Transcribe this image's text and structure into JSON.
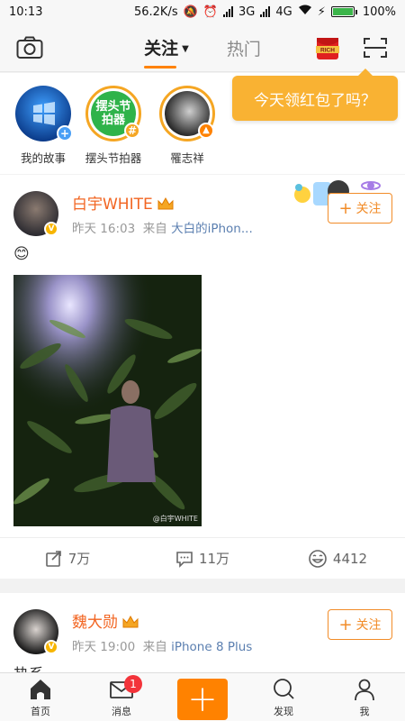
{
  "status_bar": {
    "time": "10:13",
    "net_speed": "56.2K/s",
    "net_3g": "3G",
    "net_4g": "4G",
    "battery": "100%"
  },
  "top_nav": {
    "tabs": [
      {
        "label": "关注",
        "active": true
      },
      {
        "label": "热门",
        "active": false
      }
    ],
    "rich_label": "RICH",
    "accent_color": "#ff8200"
  },
  "tooltip": {
    "text": "今天领红包了吗？"
  },
  "stories": [
    {
      "label": "我的故事",
      "badge": "+",
      "badge_color": "#4a9ff5"
    },
    {
      "label": "摆头节拍器",
      "badge": "#",
      "badge_color": "#f5a623",
      "inner_text": "摆头节拍器"
    },
    {
      "label": "罹志祥",
      "badge": "🔥",
      "badge_color": "#ff8200"
    }
  ],
  "posts": [
    {
      "username": "白宇WHITE",
      "time": "昨天 16:03",
      "from_label": "来自",
      "source": "大白的iPhon...",
      "follow_label": "关注",
      "content_emoji": "😊",
      "watermark": "@白宇WHITE",
      "actions": {
        "repost": "7万",
        "comment": "11万",
        "like": "4412"
      }
    },
    {
      "username": "魏大勋",
      "time": "昨天 19:00",
      "from_label": "来自",
      "source": "iPhone 8 Plus",
      "follow_label": "关注",
      "content_partial": "热系"
    }
  ],
  "bottom_nav": {
    "items": [
      {
        "label": "首页",
        "icon": "home-icon"
      },
      {
        "label": "消息",
        "icon": "mail-icon",
        "badge": "1"
      },
      {
        "label": "",
        "icon": "plus-icon"
      },
      {
        "label": "发现",
        "icon": "search-icon"
      },
      {
        "label": "我",
        "icon": "profile-icon"
      }
    ]
  }
}
